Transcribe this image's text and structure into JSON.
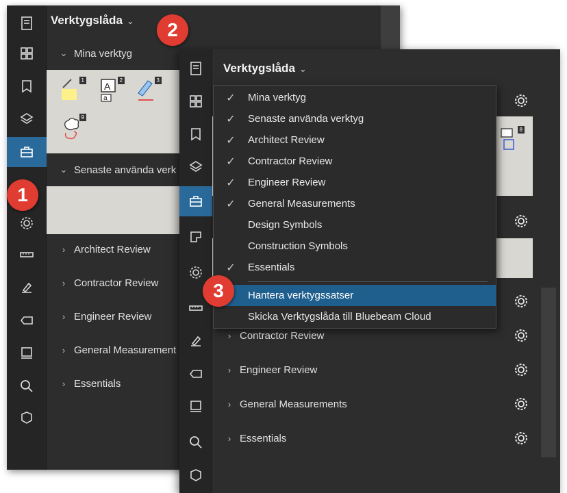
{
  "back_panel": {
    "title": "Verktygslåda",
    "sections": [
      {
        "label": "Mina verktyg",
        "expanded": true
      },
      {
        "label": "Senaste använda verk",
        "expanded": true
      },
      {
        "label": "Architect Review",
        "expanded": false
      },
      {
        "label": "Contractor Review",
        "expanded": false
      },
      {
        "label": "Engineer Review",
        "expanded": false
      },
      {
        "label": "General Measurement",
        "expanded": false
      },
      {
        "label": "Essentials",
        "expanded": false
      }
    ],
    "tool_numbers": [
      "1",
      "2",
      "3",
      "9"
    ]
  },
  "front_panel": {
    "title": "Verktygslåda",
    "sections": [
      {
        "label": "Contractor Review"
      },
      {
        "label": "Engineer Review"
      },
      {
        "label": "General Measurements"
      },
      {
        "label": "Essentials"
      }
    ],
    "tool_number": "8"
  },
  "dropdown_menu": {
    "items": [
      {
        "label": "Mina verktyg",
        "checked": true
      },
      {
        "label": "Senaste använda verktyg",
        "checked": true
      },
      {
        "label": "Architect Review",
        "checked": true
      },
      {
        "label": "Contractor Review",
        "checked": true
      },
      {
        "label": "Engineer Review",
        "checked": true
      },
      {
        "label": "General Measurements",
        "checked": true
      },
      {
        "label": "Design Symbols",
        "checked": false
      },
      {
        "label": "Construction Symbols",
        "checked": false
      },
      {
        "label": "Essentials",
        "checked": true
      }
    ],
    "actions": [
      {
        "label": "Hantera verktygssatser",
        "highlighted": true
      },
      {
        "label": "Skicka Verktygslåda till Bluebeam Cloud",
        "highlighted": false
      }
    ]
  },
  "callouts": [
    "1",
    "2",
    "3"
  ],
  "colors": {
    "accent": "#2a6a9b",
    "highlight": "#1f5f8e",
    "callout": "#e03c31",
    "tool_area": "#d9d7d2"
  }
}
